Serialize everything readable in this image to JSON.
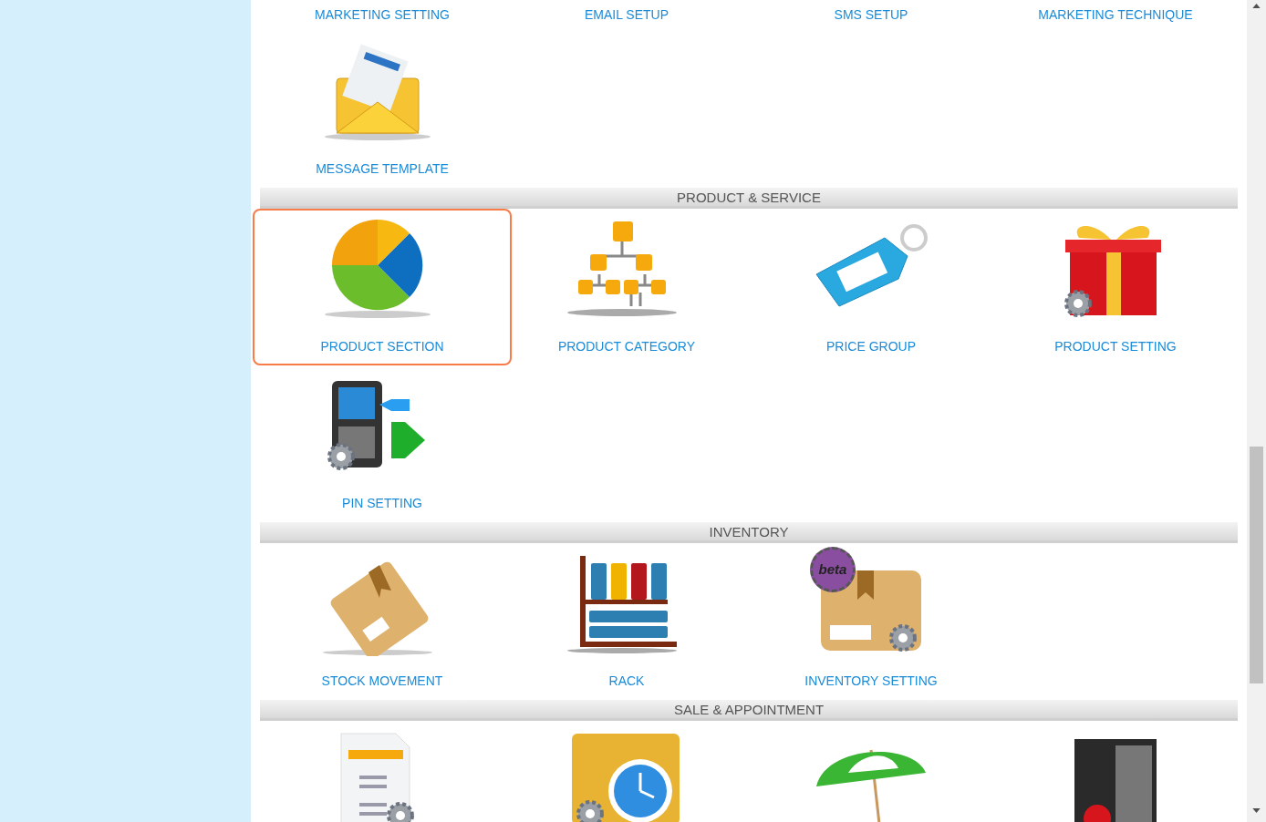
{
  "sections": [
    {
      "items": [
        {
          "label": "MARKETING SETTING",
          "selected": false
        },
        {
          "label": "EMAIL SETUP",
          "selected": false
        },
        {
          "label": "SMS SETUP",
          "selected": false
        },
        {
          "label": "MARKETING TECHNIQUE",
          "selected": false
        },
        {
          "label": "MESSAGE TEMPLATE",
          "kind": "envelope",
          "selected": false
        }
      ]
    },
    {
      "title": "PRODUCT & SERVICE",
      "items": [
        {
          "label": "PRODUCT SECTION",
          "kind": "pie",
          "selected": true
        },
        {
          "label": "PRODUCT CATEGORY",
          "kind": "hierarchy",
          "selected": false
        },
        {
          "label": "PRICE GROUP",
          "kind": "tag",
          "selected": false
        },
        {
          "label": "PRODUCT SETTING",
          "kind": "gift",
          "selected": false
        },
        {
          "label": "PIN SETTING",
          "kind": "phone",
          "selected": false
        }
      ]
    },
    {
      "title": "INVENTORY",
      "items": [
        {
          "label": "STOCK MOVEMENT",
          "kind": "box",
          "selected": false
        },
        {
          "label": "RACK",
          "kind": "rack",
          "selected": false
        },
        {
          "label": "INVENTORY SETTING",
          "kind": "box",
          "badge": "beta",
          "selected": false
        }
      ]
    },
    {
      "title": "SALE & APPOINTMENT",
      "items": [
        {
          "kind": "invoice",
          "selected": false
        },
        {
          "kind": "calendar",
          "selected": false
        },
        {
          "kind": "umbrella",
          "selected": false
        },
        {
          "kind": "locker",
          "selected": false
        }
      ]
    }
  ]
}
